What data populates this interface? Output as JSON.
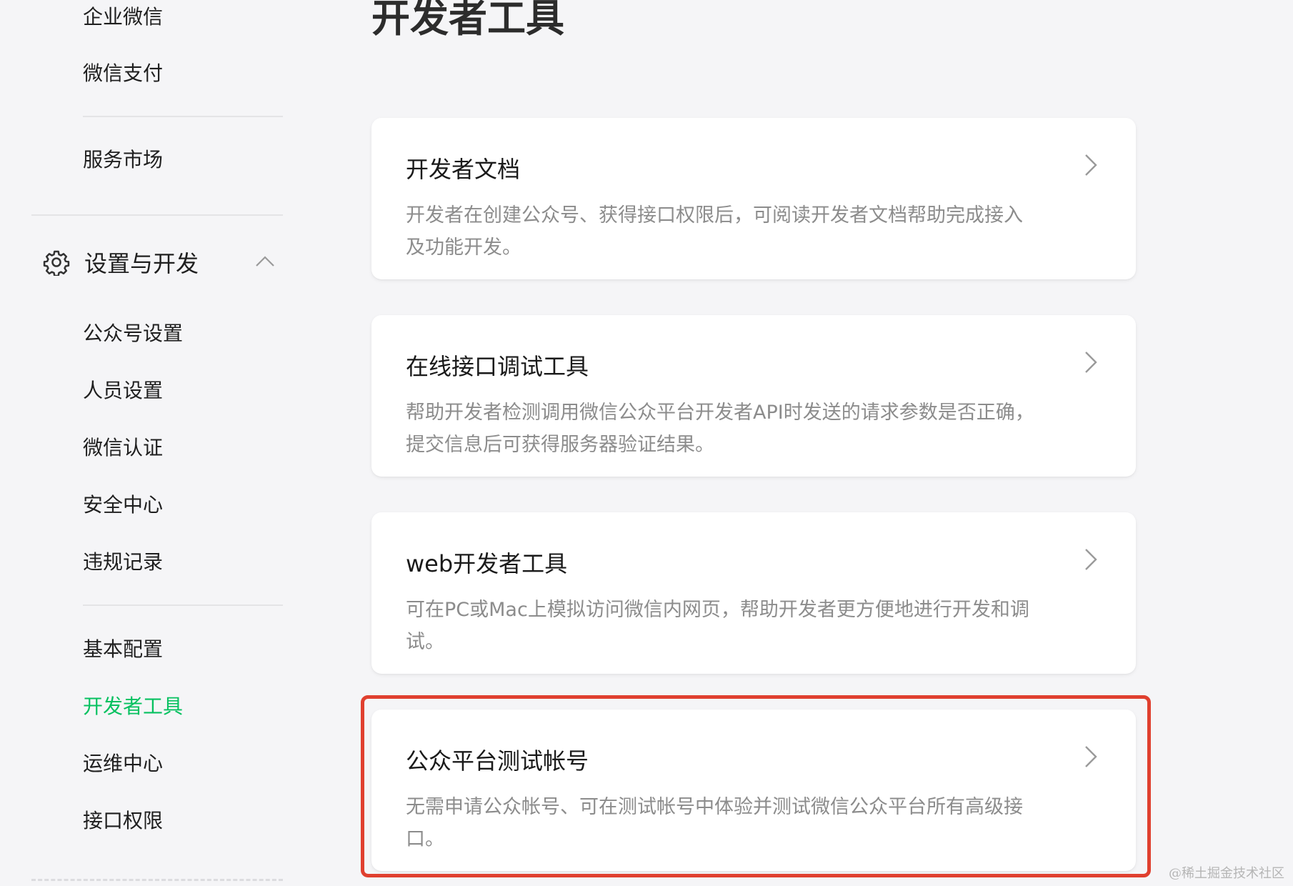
{
  "sidebar": {
    "top_items": [
      {
        "label": "企业微信"
      },
      {
        "label": "微信支付"
      }
    ],
    "market_item": {
      "label": "服务市场"
    },
    "section": {
      "label": "设置与开发",
      "icon": "gear-icon",
      "expanded": true
    },
    "section_items": [
      {
        "label": "公众号设置"
      },
      {
        "label": "人员设置"
      },
      {
        "label": "微信认证"
      },
      {
        "label": "安全中心"
      },
      {
        "label": "违规记录"
      }
    ],
    "dev_items": [
      {
        "label": "基本配置"
      },
      {
        "label": "开发者工具",
        "active": true
      },
      {
        "label": "运维中心"
      },
      {
        "label": "接口权限"
      }
    ]
  },
  "main": {
    "title": "开发者工具",
    "cards": [
      {
        "title": "开发者文档",
        "desc": "开发者在创建公众号、获得接口权限后，可阅读开发者文档帮助完成接入及功能开发。"
      },
      {
        "title": "在线接口调试工具",
        "desc": "帮助开发者检测调用微信公众平台开发者API时发送的请求参数是否正确，提交信息后可获得服务器验证结果。"
      },
      {
        "title": "web开发者工具",
        "desc": "可在PC或Mac上模拟访问微信内网页，帮助开发者更方便地进行开发和调试。"
      },
      {
        "title": "公众平台测试帐号",
        "desc": "无需申请公众帐号、可在测试帐号中体验并测试微信公众平台所有高级接口。",
        "highlighted": true
      }
    ]
  },
  "watermark": "@稀土掘金技术社区",
  "colors": {
    "active": "#07c160",
    "highlight": "#e0402f"
  }
}
